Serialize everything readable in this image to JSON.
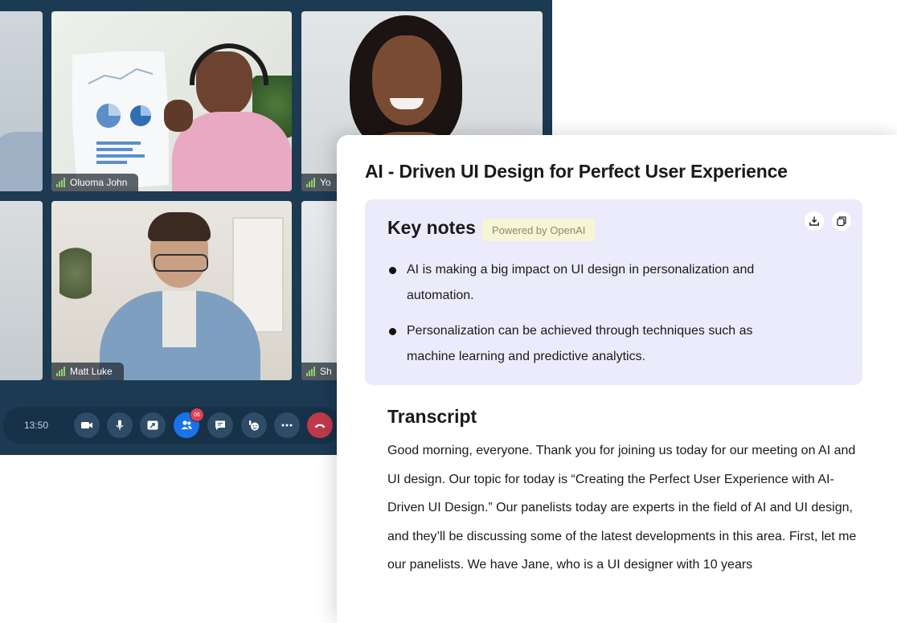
{
  "call": {
    "participants": [
      {
        "name": "Oluoma John"
      },
      {
        "name": "Yo"
      },
      {
        "name": "Matt Luke"
      },
      {
        "name": "Sh"
      }
    ],
    "time": "13:50",
    "participants_badge": "06",
    "colors": {
      "window_bg": "#1c3a52",
      "toolbar_bg": "#163148",
      "active": "#1a73e8",
      "hangup": "#c0394b"
    },
    "controls": [
      "video-icon",
      "microphone-icon",
      "share-screen-icon",
      "participants-icon",
      "chat-icon",
      "reactions-icon",
      "more-icon",
      "hang-up-icon"
    ]
  },
  "panel": {
    "title": "AI - Driven UI Design for Perfect User Experience",
    "key_notes": {
      "title": "Key notes",
      "powered_by": "Powered by OpenAI",
      "items": [
        "AI is making a big impact on UI design in personalization and automation.",
        "Personalization can be achieved through techniques such as machine learning and predictive analytics."
      ],
      "icons": [
        "download-icon",
        "copy-icon"
      ]
    },
    "transcript": {
      "title": "Transcript",
      "text": "Good morning, everyone. Thank you for joining us today for our meeting on AI and UI design. Our topic for today is “Creating the Perfect User Experience with AI-Driven UI Design.” Our panelists today are experts in the field of AI and UI design, and they’ll be discussing some of the latest developments in this area. First, let me our panelists. We have Jane, who is a UI designer with 10 years"
    }
  }
}
